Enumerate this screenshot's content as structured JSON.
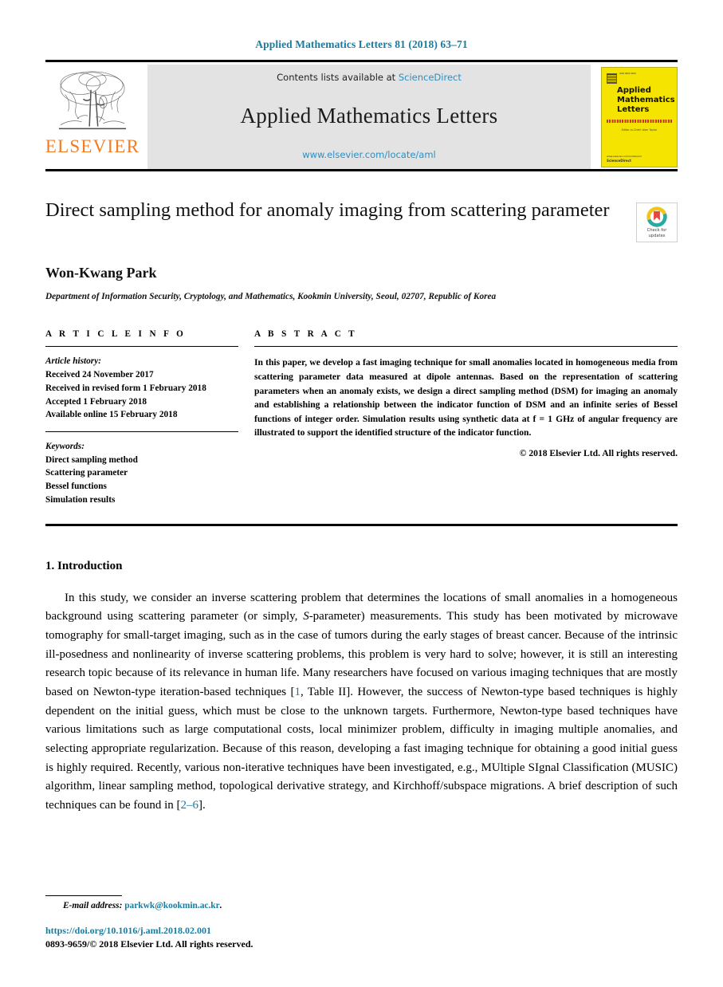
{
  "running_head": "Applied Mathematics Letters 81 (2018) 63–71",
  "masthead": {
    "contents_prefix": "Contents lists available at",
    "sciencedirect": "ScienceDirect",
    "journal_name": "Applied Mathematics Letters",
    "journal_url": "www.elsevier.com/locate/aml",
    "publisher_logo_text": "ELSEVIER",
    "cover": {
      "issn_line": "ISSN 0893-9659",
      "title_line1": "Applied",
      "title_line2": "Mathematics",
      "title_line3": "Letters",
      "subtitle": "Editor-in-Chief: Alan Taylor",
      "bottom_brand": "ScienceDirect",
      "bottom_url": "www.elsevier.com/locate/aml"
    }
  },
  "article": {
    "title": "Direct sampling method for anomaly imaging from scattering parameter",
    "crossmark_label_line1": "Check for",
    "crossmark_label_line2": "updates",
    "author": "Won-Kwang Park",
    "affiliation": "Department of Information Security, Cryptology, and Mathematics, Kookmin University, Seoul, 02707, Republic of Korea"
  },
  "info": {
    "heading": "A R T I C L E   I N F O",
    "history_title": "Article history:",
    "history": [
      "Received 24 November 2017",
      "Received in revised form 1 February 2018",
      "Accepted 1 February 2018",
      "Available online 15 February 2018"
    ],
    "keywords_title": "Keywords:",
    "keywords": [
      "Direct sampling method",
      "Scattering parameter",
      "Bessel functions",
      "Simulation results"
    ]
  },
  "abstract": {
    "heading": "A B S T R A C T",
    "text": "In this paper, we develop a fast imaging technique for small anomalies located in homogeneous media from scattering parameter data measured at dipole antennas. Based on the representation of scattering parameters when an anomaly exists, we design a direct sampling method (DSM) for imaging an anomaly and establishing a relationship between the indicator function of DSM and an infinite series of Bessel functions of integer order. Simulation results using synthetic data at f = 1 GHz of angular frequency are illustrated to support the identified structure of the indicator function.",
    "copyright": "© 2018 Elsevier Ltd. All rights reserved."
  },
  "body": {
    "section_number": "1.",
    "section_title": "Introduction",
    "paragraph_part1": "In this study, we consider an inverse scattering problem that determines the locations of small anomalies in a homogeneous background using scattering parameter (or simply, ",
    "s_param_italic": "S",
    "paragraph_part2": "-parameter) measurements. This study has been motivated by microwave tomography for small-target imaging, such as in the case of tumors during the early stages of breast cancer. Because of the intrinsic ill-posedness and nonlinearity of inverse scattering problems, this problem is very hard to solve; however, it is still an interesting research topic because of its relevance in human life. Many researchers have focused on various imaging techniques that are mostly based on Newton-type iteration-based techniques [",
    "citation_1": "1",
    "paragraph_part3": ", Table II]. However, the success of Newton-type based techniques is highly dependent on the initial guess, which must be close to the unknown targets. Furthermore, Newton-type based techniques have various limitations such as large computational costs, local minimizer problem, difficulty in imaging multiple anomalies, and selecting appropriate regularization. Because of this reason, developing a fast imaging technique for obtaining a good initial guess is highly required. Recently, various non-iterative techniques have been investigated, e.g., MUltiple SIgnal Classification (MUSIC) algorithm, linear sampling method, topological derivative strategy, and Kirchhoff/subspace migrations. A brief description of such techniques can be found in [",
    "citation_2": "2–6",
    "paragraph_part4": "]."
  },
  "footer": {
    "email_label": "E-mail address:",
    "email": "parkwk@kookmin.ac.kr",
    "email_period": ".",
    "doi": "https://doi.org/10.1016/j.aml.2018.02.001",
    "issn_line": "0893-9659/© 2018 Elsevier Ltd. All rights reserved."
  },
  "colors": {
    "link": "#1a7b9e",
    "sciencedirect": "#2b8fc4",
    "elsevier_orange": "#f47b20",
    "cover_yellow": "#f5e400",
    "masthead_gray": "#e3e3e3"
  }
}
